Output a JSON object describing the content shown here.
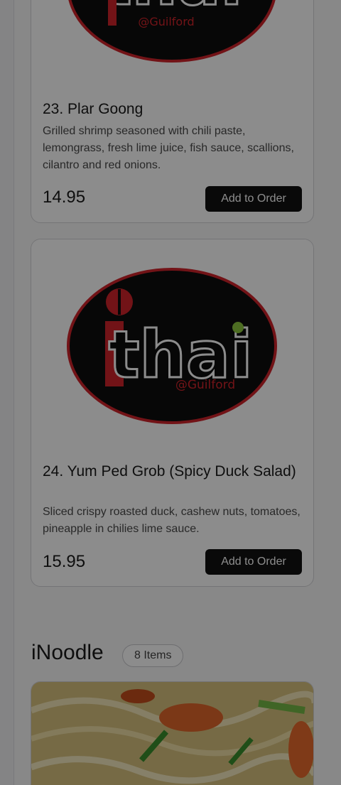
{
  "menu": {
    "items": [
      {
        "title": "23. Plar Goong",
        "description": "Grilled shrimp seasoned with chili paste, lemongrass, fresh lime juice, fish sauce, scallions, cilantro and red onions.",
        "price": "14.95",
        "button": "Add to Order"
      },
      {
        "title": "24. Yum Ped Grob (Spicy Duck Salad)",
        "description": "Sliced crispy roasted duck, cashew nuts, tomatoes, pineapple in chilies lime sauce.",
        "price": "15.95",
        "button": "Add to Order"
      }
    ],
    "logo": {
      "word": "thai",
      "subtitle": "@Guilford"
    }
  },
  "section": {
    "title": "iNoodle",
    "count": "8 Items"
  },
  "colors": {
    "logo_red": "#d0242a",
    "logo_black": "#0e0e0e",
    "logo_green": "#8dc63f",
    "button_bg": "#111111"
  }
}
